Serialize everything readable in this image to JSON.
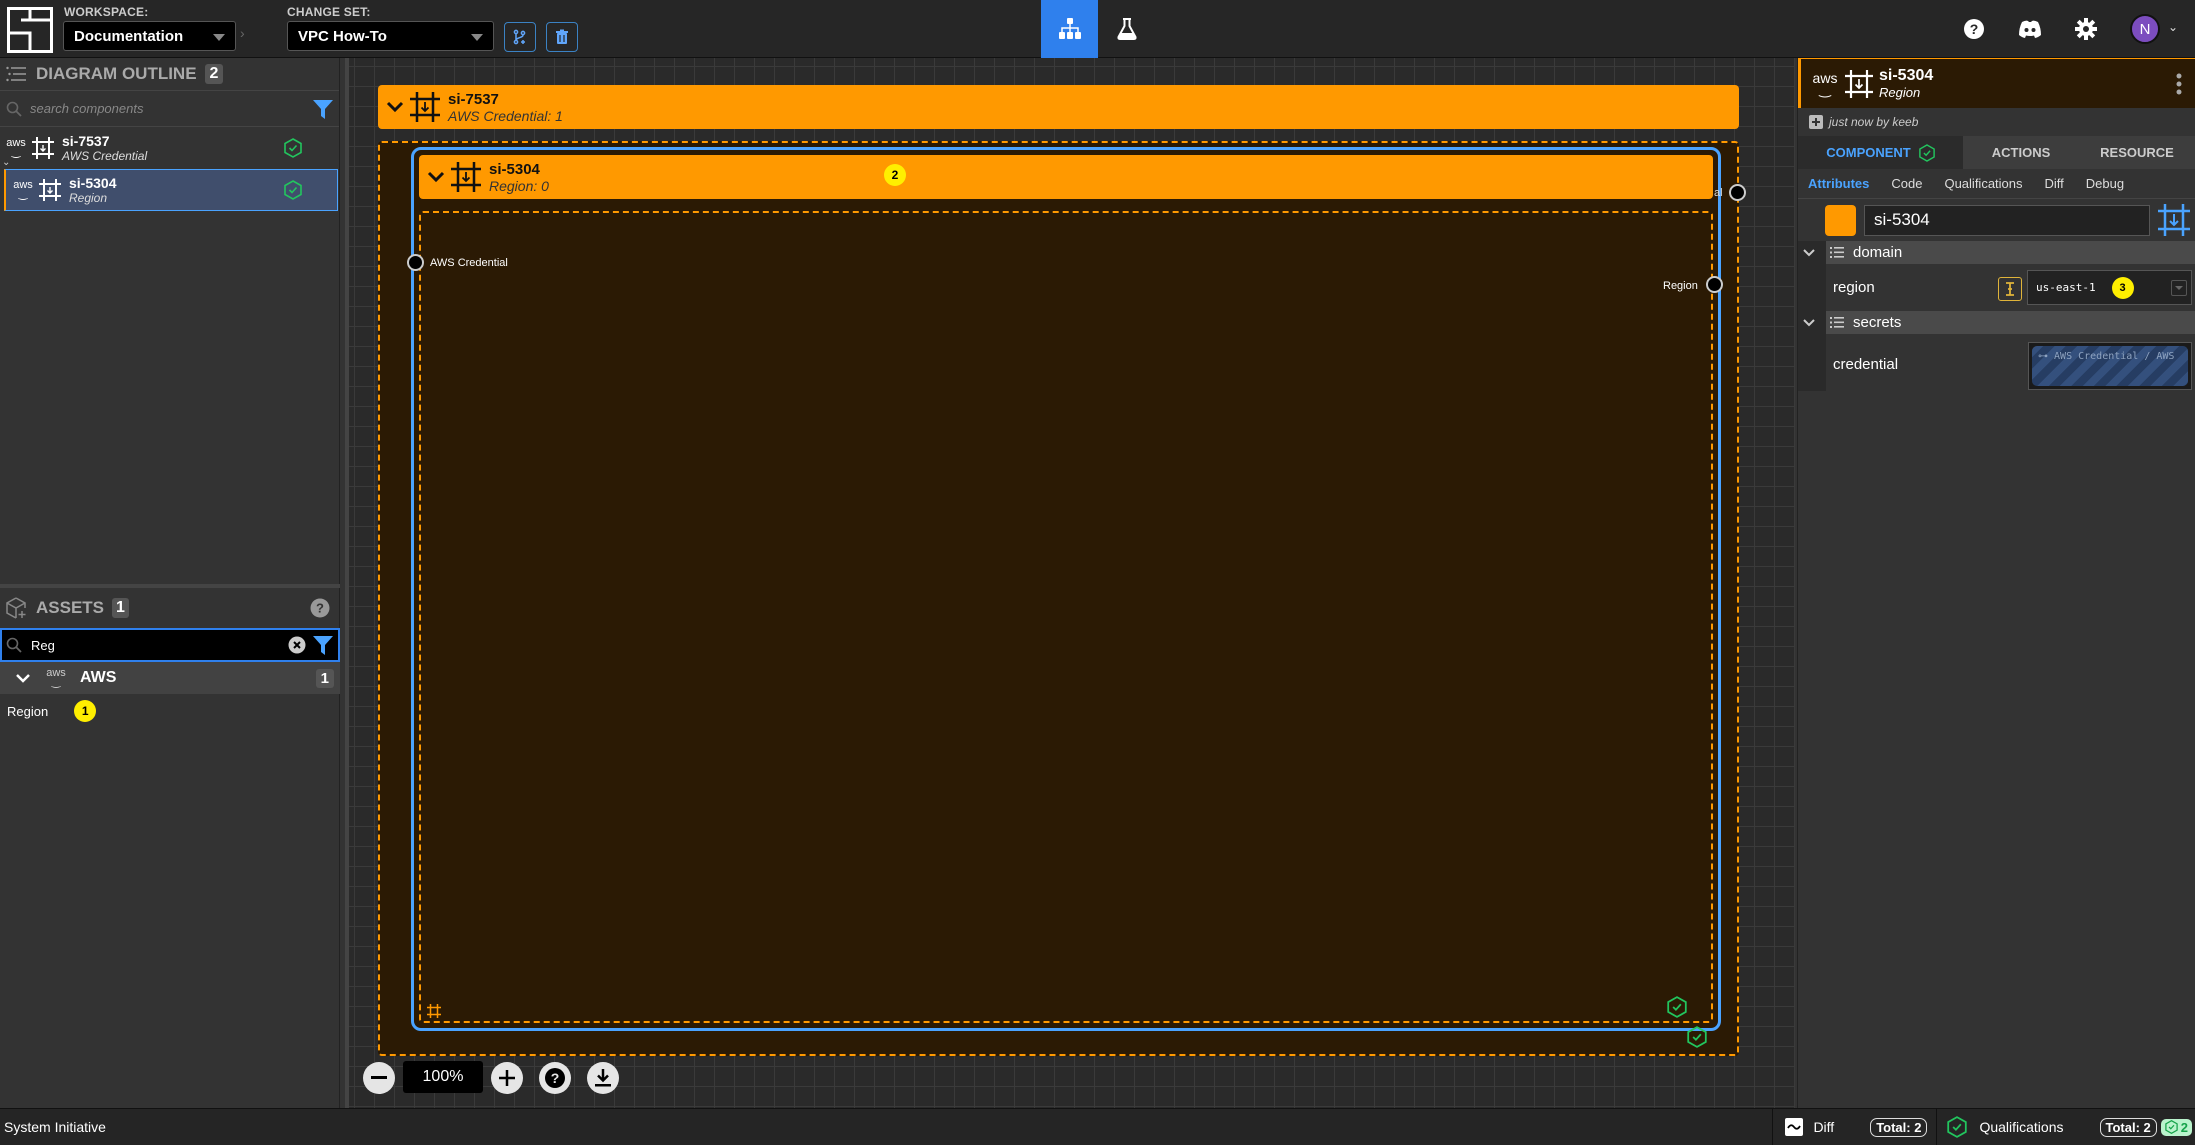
{
  "topbar": {
    "workspace_label": "WORKSPACE:",
    "workspace_value": "Documentation",
    "changeset_label": "CHANGE SET:",
    "changeset_value": "VPC How-To",
    "avatar_initial": "N",
    "nav_tabs": [
      {
        "icon": "diagram-icon",
        "active": true
      },
      {
        "icon": "flask-icon",
        "active": false
      }
    ]
  },
  "outline": {
    "title": "DIAGRAM OUTLINE",
    "count": "2",
    "search_placeholder": "search components",
    "items": [
      {
        "name": "si-7537",
        "type": "AWS Credential",
        "vendor": "aws",
        "status": "qualified",
        "selected": false
      },
      {
        "name": "si-5304",
        "type": "Region",
        "vendor": "aws",
        "status": "qualified",
        "selected": true
      }
    ]
  },
  "assets": {
    "title": "ASSETS",
    "count": "1",
    "search_value": "Reg",
    "groups": [
      {
        "name": "AWS",
        "count": "1",
        "items": [
          {
            "label": "Region",
            "step_badge": "1"
          }
        ]
      }
    ]
  },
  "canvas": {
    "frames": [
      {
        "name": "si-7537",
        "subtitle": "AWS Credential: 1"
      },
      {
        "name": "si-5304",
        "subtitle": "Region: 0",
        "step_badge": "2",
        "input_socket": "AWS Credential",
        "output_socket": "Region",
        "output_socket_partial": "al"
      }
    ],
    "zoom_level": "100%"
  },
  "details": {
    "name": "si-5304",
    "type": "Region",
    "vendor": "aws",
    "history": "just now by keeb",
    "tabs": [
      "COMPONENT",
      "ACTIONS",
      "RESOURCE"
    ],
    "active_tab": "COMPONENT",
    "subtabs": [
      "Attributes",
      "Code",
      "Qualifications",
      "Diff",
      "Debug"
    ],
    "active_subtab": "Attributes",
    "color": "#ff9900",
    "name_input_value": "si-5304",
    "sections": [
      {
        "title": "domain",
        "props": [
          {
            "label": "region",
            "value": "us-east-1",
            "step_badge": "3"
          }
        ]
      },
      {
        "title": "secrets",
        "props": [
          {
            "label": "credential",
            "value": "AWS Credential / AWS"
          }
        ]
      }
    ]
  },
  "statusbar": {
    "app_name": "System Initiative",
    "diff_label": "Diff",
    "diff_total": "Total: 2",
    "qual_label": "Qualifications",
    "qual_total": "Total: 2",
    "qual_passed": "2"
  },
  "colors": {
    "accent": "#2f80ed",
    "frame": "#ff9900",
    "success": "#22c55e",
    "badge": "#ffef00"
  }
}
